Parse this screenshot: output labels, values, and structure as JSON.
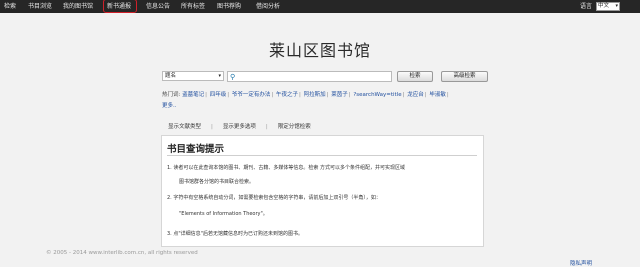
{
  "nav": {
    "items": [
      "检索",
      "书目浏览",
      "我的图书馆",
      "新书通报",
      "信息公告",
      "所有标签",
      "图书荐购",
      "借阅分析"
    ],
    "lang_label": "语言",
    "lang_value": "中文"
  },
  "title": "莱山区图书馆",
  "search": {
    "field": "题名",
    "search_button": "检索",
    "advanced_button": "高级检索"
  },
  "hot": {
    "label": "热门词:",
    "words": [
      "盗墓笔记",
      "四年级",
      "爷爷一定有办法",
      "午夜之子",
      "阿拉斯加",
      "莱茵子",
      "?searchWay=title",
      "龙应台",
      "毕淑敏"
    ],
    "more": "更多.."
  },
  "options": [
    "显示文献类型",
    "显示更多选项",
    "限定分馆检索"
  ],
  "help": {
    "heading": "书目查询提示",
    "p1a": "1.    读者可以在此查询本馆的图书、期刊、古籍、多媒体等信息。检索 方式可以多个条件组配，并可实现区域",
    "p1b": "图书馆群各分馆的书目联合检索。",
    "p2a": "2.    字符中有空格系统自动分词，如需要检索包含空格的字符串，请前后加上双引号（半角），如：",
    "p2b": "\"Elements of Information Theory\"。",
    "p3": "3.    点\"详细信息\"后若无馆藏信息时为已订购还未到馆的图书。"
  },
  "footer": {
    "copyright": "© 2005 - 2014 www.interlib.com.cn, all rights reserved",
    "privacy": "隐私声明"
  }
}
